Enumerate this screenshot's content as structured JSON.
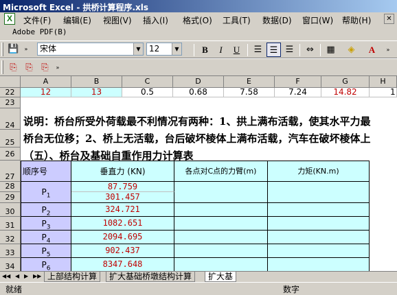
{
  "window": {
    "title": "Microsoft Excel - 拱桥计算程序.xls"
  },
  "menu": [
    "文件(F)",
    "编辑(E)",
    "视图(V)",
    "插入(I)",
    "格式(O)",
    "工具(T)",
    "数据(D)",
    "窗口(W)",
    "帮助(H)"
  ],
  "pdf_toolbar": {
    "label": "Adobe PDF(B)"
  },
  "format_toolbar": {
    "font_name": "宋体",
    "font_size": "12",
    "bold": "B",
    "italic": "I",
    "underline": "U"
  },
  "columns": [
    "A",
    "B",
    "C",
    "D",
    "E",
    "F",
    "G",
    "H"
  ],
  "rows": [
    "22",
    "23",
    "24",
    "25",
    "26",
    "27",
    "28",
    "29",
    "30",
    "31",
    "32",
    "33",
    "34"
  ],
  "row22": [
    "12",
    "13",
    "0.5",
    "0.68",
    "7.58",
    "7.24",
    "14.82",
    "1"
  ],
  "text": {
    "r24": "说明：桥台所受外荷载最不利情况有两种：1、拱上满布活载，使其水平力最",
    "r25": "桥台无位移；2、桥上无活载，台后破坏棱体上满布活载，汽车在破坏棱体上",
    "r26": "（五）、桥台及基础自重作用力计算表"
  },
  "table": {
    "headers": [
      "顺序号",
      "垂直力 (KN)",
      "各点对C点的力臂(m)",
      "力矩(KN.m)"
    ],
    "p_labels": [
      "P",
      "P",
      "P",
      "P",
      "P",
      "P"
    ],
    "p_subs": [
      "1",
      "2",
      "3",
      "4",
      "5",
      "6"
    ],
    "values": [
      "87.759",
      "301.457",
      "324.721",
      "1082.651",
      "2094.695",
      "902.437",
      "8347.648"
    ]
  },
  "sheets": [
    "上部结构计算",
    "扩大基础桥墩结构计算",
    "扩大基"
  ],
  "status": {
    "left": "就绪",
    "right": "数字"
  }
}
